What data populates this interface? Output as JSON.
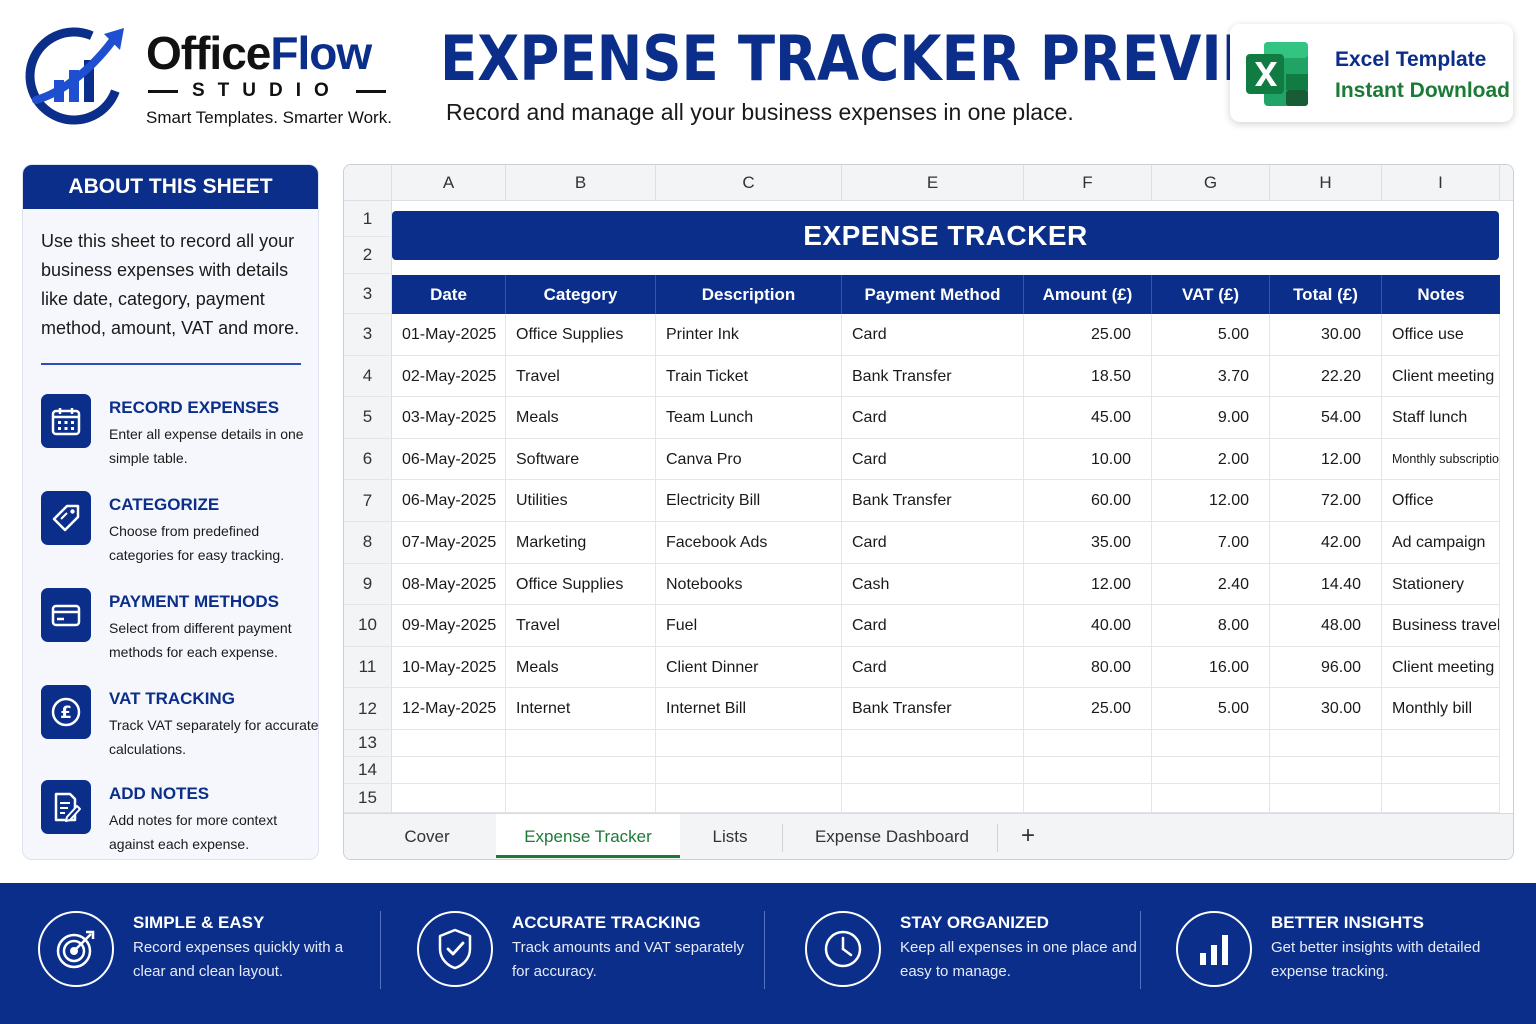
{
  "brand": {
    "name_part1": "Office",
    "name_part2": "Flow",
    "studio": "STUDIO",
    "tagline": "Smart Templates. Smarter Work."
  },
  "header": {
    "title": "EXPENSE TRACKER PREVIEW",
    "subtitle": "Record and manage all your business expenses in one place."
  },
  "badge": {
    "line1": "Excel Template",
    "line2": "Instant Download",
    "icon": "excel-icon"
  },
  "about": {
    "heading": "ABOUT THIS SHEET",
    "description": "Use this sheet to record all your business expenses with details like date, category, payment method, amount, VAT and more.",
    "features": [
      {
        "title": "RECORD EXPENSES",
        "desc": "Enter all expense details in one simple table.",
        "icon": "calendar-icon"
      },
      {
        "title": "CATEGORIZE",
        "desc": "Choose from predefined categories for easy tracking.",
        "icon": "tag-icon"
      },
      {
        "title": "PAYMENT METHODS",
        "desc": "Select from different payment methods for each expense.",
        "icon": "credit-card-icon"
      },
      {
        "title": "VAT TRACKING",
        "desc": "Track VAT separately for accurate calculations.",
        "icon": "pound-icon"
      },
      {
        "title": "ADD NOTES",
        "desc": "Add notes for more context against each expense.",
        "icon": "notes-icon"
      }
    ]
  },
  "sheet": {
    "column_letters": [
      "A",
      "B",
      "C",
      "E",
      "F",
      "G",
      "H",
      "I"
    ],
    "row_numbers": [
      "1",
      "2",
      "3",
      "3",
      "4",
      "5",
      "6",
      "7",
      "8",
      "9",
      "10",
      "11",
      "12",
      "13",
      "14",
      "15"
    ],
    "banner": "EXPENSE TRACKER",
    "headers": [
      "Date",
      "Category",
      "Description",
      "Payment Method",
      "Amount (£)",
      "VAT (£)",
      "Total (£)",
      "Notes"
    ],
    "rows": [
      [
        "01-May-2025",
        "Office Supplies",
        "Printer Ink",
        "Card",
        "25.00",
        "5.00",
        "30.00",
        "Office use"
      ],
      [
        "02-May-2025",
        "Travel",
        "Train Ticket",
        "Bank Transfer",
        "18.50",
        "3.70",
        "22.20",
        "Client meeting"
      ],
      [
        "03-May-2025",
        "Meals",
        "Team Lunch",
        "Card",
        "45.00",
        "9.00",
        "54.00",
        "Staff lunch"
      ],
      [
        "06-May-2025",
        "Software",
        "Canva Pro",
        "Card",
        "10.00",
        "2.00",
        "12.00",
        "Monthly subscription"
      ],
      [
        "06-May-2025",
        "Utilities",
        "Electricity Bill",
        "Bank Transfer",
        "60.00",
        "12.00",
        "72.00",
        "Office"
      ],
      [
        "07-May-2025",
        "Marketing",
        "Facebook Ads",
        "Card",
        "35.00",
        "7.00",
        "42.00",
        "Ad campaign"
      ],
      [
        "08-May-2025",
        "Office Supplies",
        "Notebooks",
        "Cash",
        "12.00",
        "2.40",
        "14.40",
        "Stationery"
      ],
      [
        "09-May-2025",
        "Travel",
        "Fuel",
        "Card",
        "40.00",
        "8.00",
        "48.00",
        "Business travel"
      ],
      [
        "10-May-2025",
        "Meals",
        "Client Dinner",
        "Card",
        "80.00",
        "16.00",
        "96.00",
        "Client meeting"
      ],
      [
        "12-May-2025",
        "Internet",
        "Internet Bill",
        "Bank Transfer",
        "25.00",
        "5.00",
        "30.00",
        "Monthly bill"
      ]
    ],
    "tabs": [
      "Cover",
      "Expense Tracker",
      "Lists",
      "Expense Dashboard"
    ],
    "active_tab": "Expense Tracker",
    "add_tab": "+"
  },
  "benefits": [
    {
      "title": "SIMPLE & EASY",
      "desc": "Record expenses quickly with a clear and clean layout.",
      "icon": "target-icon"
    },
    {
      "title": "ACCURATE TRACKING",
      "desc": "Track amounts and VAT separately for accuracy.",
      "icon": "shield-check-icon"
    },
    {
      "title": "STAY ORGANIZED",
      "desc": "Keep all expenses in one place and easy to manage.",
      "icon": "clock-icon"
    },
    {
      "title": "BETTER INSIGHTS",
      "desc": "Get better insights with detailed expense tracking.",
      "icon": "bar-chart-icon"
    }
  ],
  "colors": {
    "primary": "#0b2e8a",
    "excel_green": "#1b7a36",
    "footer_text": "#e6ebf7"
  }
}
